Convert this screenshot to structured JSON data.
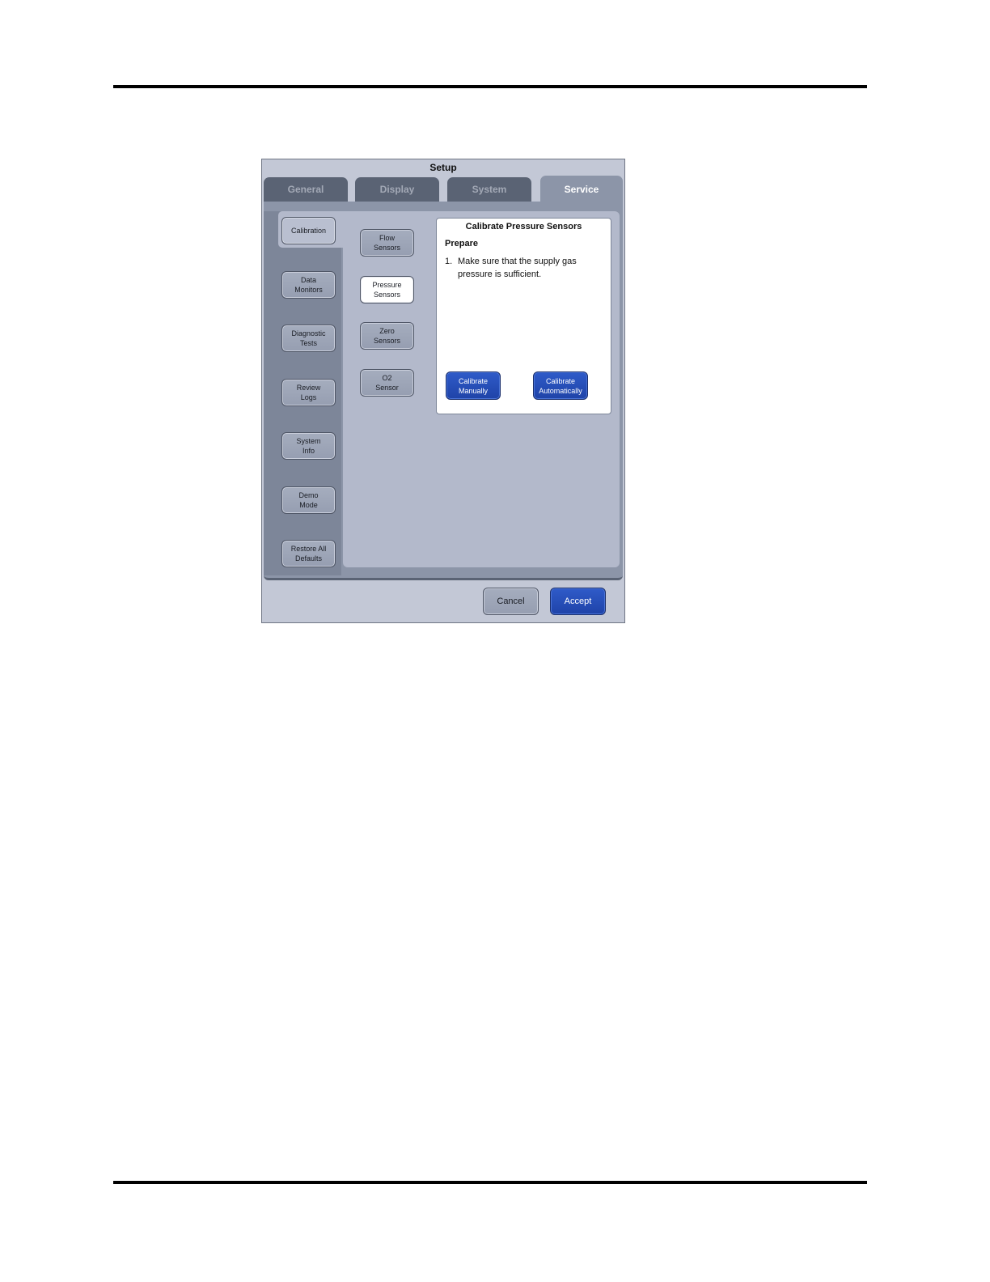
{
  "window": {
    "title": "Setup"
  },
  "tabs": [
    {
      "label": "General",
      "active": false
    },
    {
      "label": "Display",
      "active": false
    },
    {
      "label": "System",
      "active": false
    },
    {
      "label": "Service",
      "active": true
    }
  ],
  "left_menu": [
    {
      "label": "Calibration",
      "active": true
    },
    {
      "label": "Data\nMonitors"
    },
    {
      "label": "Diagnostic\nTests"
    },
    {
      "label": "Review\nLogs"
    },
    {
      "label": "System\nInfo"
    },
    {
      "label": "Demo\nMode"
    },
    {
      "label": "Restore All\nDefaults"
    }
  ],
  "sub_menu": [
    {
      "label": "Flow\nSensors"
    },
    {
      "label": "Pressure\nSensors",
      "active": true
    },
    {
      "label": "Zero\nSensors"
    },
    {
      "label": "O2\nSensor"
    }
  ],
  "panel": {
    "title": "Calibrate Pressure Sensors",
    "heading": "Prepare",
    "step_number": "1.",
    "step_text": "Make sure that the supply gas pressure is sufficient.",
    "manual_label": "Calibrate\nManually",
    "auto_label": "Calibrate\nAutomatically"
  },
  "footer": {
    "cancel_label": "Cancel",
    "accept_label": "Accept"
  },
  "colors": {
    "accent_blue": "#2f5bc9",
    "panel_bg": "#b3b9cb",
    "tab_dark": "#5a6374"
  }
}
